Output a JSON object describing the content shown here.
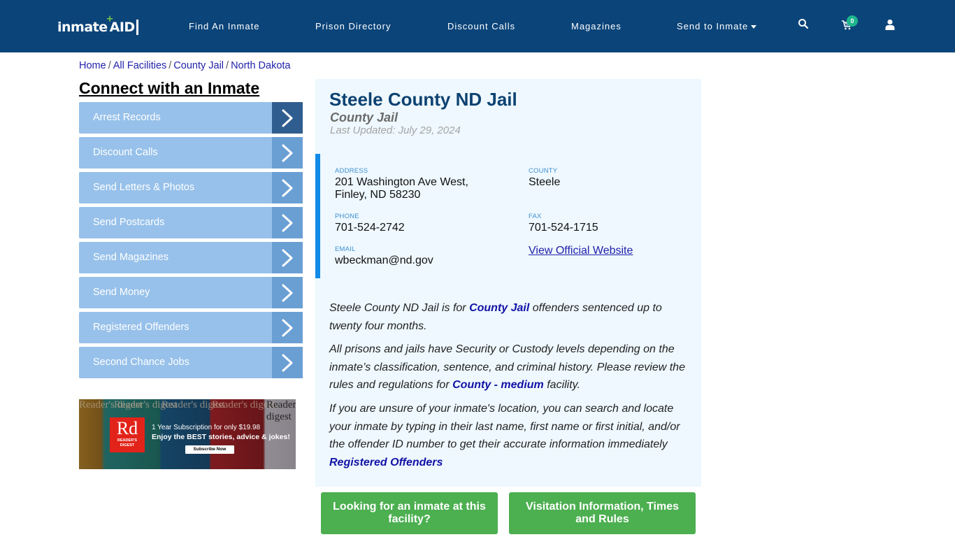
{
  "header": {
    "logo": {
      "left": "inmate",
      "right": "AID",
      "plus": "+"
    },
    "nav": [
      {
        "label": "Find An Inmate"
      },
      {
        "label": "Prison Directory"
      },
      {
        "label": "Discount Calls"
      },
      {
        "label": "Magazines"
      },
      {
        "label": "Send to Inmate",
        "has_dropdown": true
      }
    ],
    "cart_count": "0",
    "icons": [
      "search-icon",
      "cart-icon",
      "user-icon"
    ]
  },
  "breadcrumb": [
    {
      "label": "Home"
    },
    {
      "label": "All Facilities"
    },
    {
      "label": "County Jail"
    },
    {
      "label": "North Dakota"
    }
  ],
  "breadcrumb_separator": "/",
  "sidebar": {
    "title": "Connect with an Inmate",
    "items": [
      {
        "label": "Arrest Records",
        "active": true
      },
      {
        "label": "Discount Calls"
      },
      {
        "label": "Send Letters & Photos"
      },
      {
        "label": "Send Postcards"
      },
      {
        "label": "Send Magazines"
      },
      {
        "label": "Send Money"
      },
      {
        "label": "Registered Offenders"
      },
      {
        "label": "Second Chance Jobs"
      }
    ]
  },
  "ad": {
    "brand_short": "Rd",
    "brand_name": "READER'S DIGEST",
    "masthead": "Reader's digest",
    "line1": "1 Year Subscription for only $19.98",
    "line2": "Enjoy the BEST stories, advice & jokes!",
    "button": "Subscribe Now"
  },
  "facility": {
    "name": "Steele County ND Jail",
    "type": "County Jail",
    "last_updated": "Last Updated: July 29, 2024",
    "address_label": "ADDRESS",
    "address_line1": "201 Washington Ave West,",
    "address_line2": "Finley, ND 58230",
    "county_label": "COUNTY",
    "county": "Steele",
    "phone_label": "PHONE",
    "phone": "701-524-2742",
    "fax_label": "FAX",
    "fax": "701-524-1715",
    "email_label": "EMAIL",
    "email": "wbeckman@nd.gov",
    "website_link": "View Official Website"
  },
  "description": {
    "p1_a": "Steele County ND Jail is for ",
    "p1_link": "County Jail",
    "p1_b": " offenders sentenced up to twenty four months.",
    "p2_a": "All prisons and jails have Security or Custody levels depending on the inmate’s classification, sentence, and criminal history. Please review the rules and regulations for ",
    "p2_link": "County - medium",
    "p2_b": " facility.",
    "p3": "If you are unsure of your inmate's location, you can search and locate your inmate by typing in their last name, first name or first initial, and/or the offender ID number to get their accurate information immediately",
    "p3_link": "Registered Offenders"
  },
  "actions": [
    {
      "label": "Looking for an inmate at this facility?"
    },
    {
      "label": "Visitation Information, Times and Rules"
    }
  ],
  "colors": {
    "header_bg": "#0b4479",
    "sidebar_item": "#97c1ea",
    "sidebar_arrow": "#6a9fd4",
    "sidebar_arrow_active": "#2f5d8f",
    "panel_bg": "#eef8fe",
    "accent_bar": "#118ae8",
    "title": "#0d4272",
    "action_green": "#4caf50",
    "cart_badge": "#1db68c"
  }
}
